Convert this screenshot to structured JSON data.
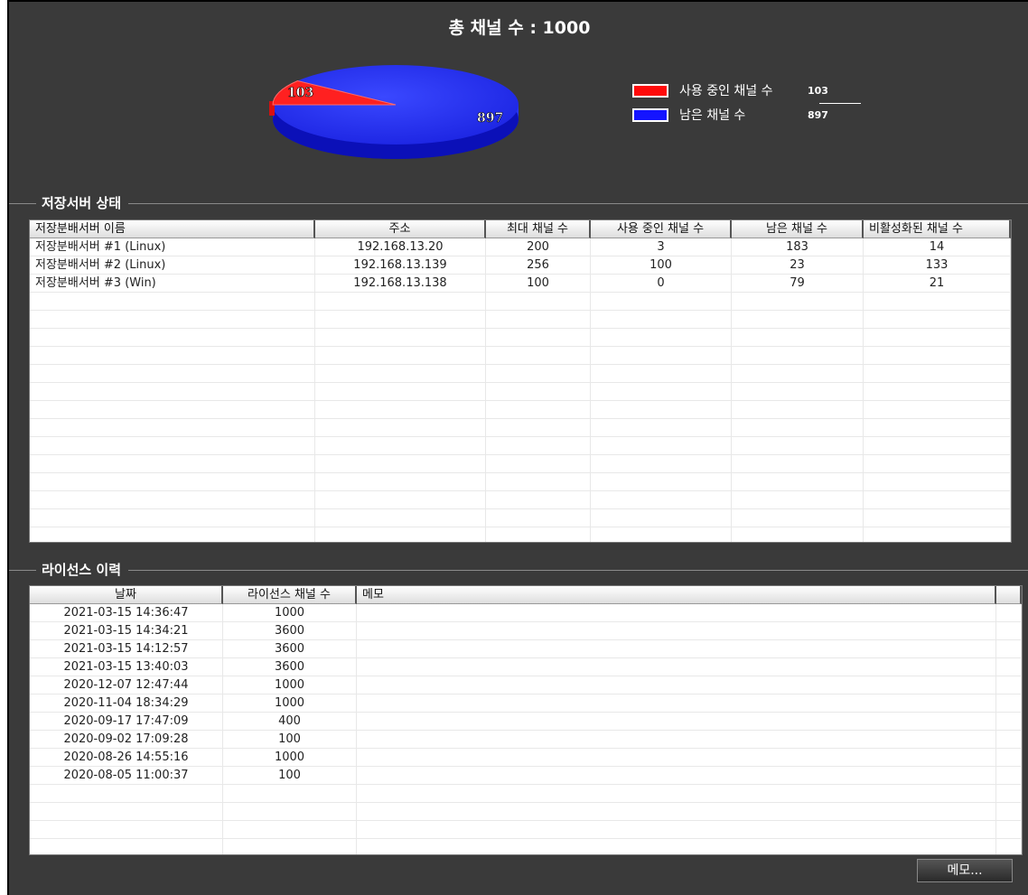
{
  "summary": {
    "total_title": "총 채널 수 : 1000",
    "used_count": "103",
    "remaining_count": "897"
  },
  "chart_data": {
    "type": "pie",
    "categories": [
      "사용 중인 채널 수",
      "남은 채널 수"
    ],
    "values": [
      103,
      897
    ],
    "colors": [
      "#ff2020",
      "#2030ff"
    ],
    "title": "총 채널 수 : 1000",
    "legend_position": "right"
  },
  "legend": {
    "items": [
      {
        "label": "사용 중인 채널 수",
        "value": "103",
        "color": "#ff0a0a"
      },
      {
        "label": "남은 채널 수",
        "value": "897",
        "color": "#1414ff"
      }
    ]
  },
  "storage": {
    "title": "저장서버 상태",
    "columns": [
      "저장분배서버 이름",
      "주소",
      "최대 채널 수",
      "사용 중인 채널 수",
      "남은 채널 수",
      "비활성화된 채널 수"
    ],
    "rows": [
      [
        "저장분배서버 #1 (Linux)",
        "192.168.13.20",
        "200",
        "3",
        "183",
        "14"
      ],
      [
        "저장분배서버 #2 (Linux)",
        "192.168.13.139",
        "256",
        "100",
        "23",
        "133"
      ],
      [
        "저장분배서버 #3 (Win)",
        "192.168.13.138",
        "100",
        "0",
        "79",
        "21"
      ]
    ]
  },
  "license": {
    "title": "라이선스 이력",
    "columns": [
      "날짜",
      "라이선스 채널 수",
      "메모"
    ],
    "rows": [
      [
        "2021-03-15 14:36:47",
        "1000",
        ""
      ],
      [
        "2021-03-15 14:34:21",
        "3600",
        ""
      ],
      [
        "2021-03-15 14:12:57",
        "3600",
        ""
      ],
      [
        "2021-03-15 13:40:03",
        "3600",
        ""
      ],
      [
        "2020-12-07 12:47:44",
        "1000",
        ""
      ],
      [
        "2020-11-04 18:34:29",
        "1000",
        ""
      ],
      [
        "2020-09-17 17:47:09",
        "400",
        ""
      ],
      [
        "2020-09-02 17:09:28",
        "100",
        ""
      ],
      [
        "2020-08-26 14:55:16",
        "1000",
        ""
      ],
      [
        "2020-08-05 11:00:37",
        "100",
        ""
      ]
    ]
  },
  "buttons": {
    "memo": "메모..."
  }
}
